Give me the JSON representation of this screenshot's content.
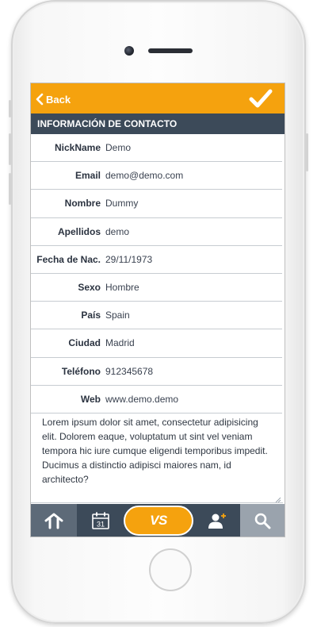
{
  "header": {
    "back_label": "Back",
    "confirm_icon": "checkmark-icon"
  },
  "section": {
    "title": "INFORMACIÓN DE CONTACTO"
  },
  "fields": [
    {
      "label": "NickName",
      "value": "Demo"
    },
    {
      "label": "Email",
      "value": "demo@demo.com"
    },
    {
      "label": "Nombre",
      "value": "Dummy"
    },
    {
      "label": "Apellidos",
      "value": "demo"
    },
    {
      "label": "Fecha de Nac.",
      "value": "29/11/1973"
    },
    {
      "label": "Sexo",
      "value": "Hombre"
    },
    {
      "label": "País",
      "value": "Spain"
    },
    {
      "label": "Ciudad",
      "value": "Madrid"
    },
    {
      "label": "Teléfono",
      "value": "912345678"
    },
    {
      "label": "Web",
      "value": "www.demo.demo"
    }
  ],
  "notes": "Lorem ipsum dolor sit amet, consectetur adipisicing elit. Dolorem eaque, voluptatum ut sint vel veniam tempora hic iure cumque eligendi temporibus impedit. Ducimus a distinctio adipisci maiores nam, id architecto?",
  "tabbar": {
    "home_icon": "home-arrow-icon",
    "calendar_icon": "calendar-icon",
    "calendar_day": "31",
    "center_label": "VS",
    "add_contact_icon": "add-user-icon",
    "search_icon": "search-icon"
  },
  "colors": {
    "accent": "#f5a20e",
    "navy": "#3c4a59",
    "home_tab": "#5d6a78",
    "search_tab": "#9aa3ad"
  }
}
